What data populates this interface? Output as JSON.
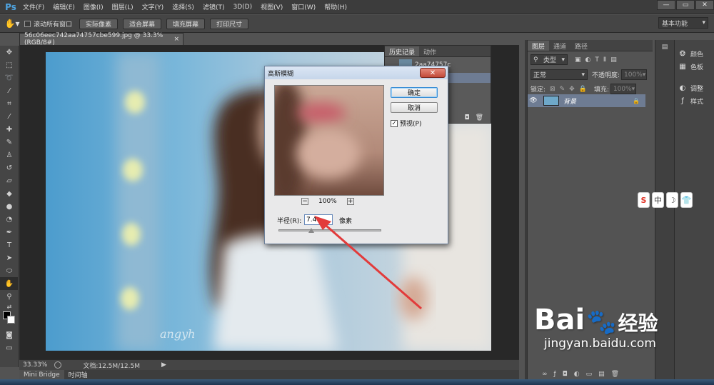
{
  "app": {
    "logo": "Ps"
  },
  "menu": [
    "文件(F)",
    "编辑(E)",
    "图像(I)",
    "图层(L)",
    "文字(Y)",
    "选择(S)",
    "滤镜(T)",
    "3D(D)",
    "视图(V)",
    "窗口(W)",
    "帮助(H)"
  ],
  "window_controls": {
    "minimize": "—",
    "restore": "▭",
    "close": "✕"
  },
  "options": {
    "scroll_all_label": "滚动所有窗口",
    "buttons": [
      "实际像素",
      "适合屏幕",
      "填充屏幕",
      "打印尺寸"
    ],
    "workspace": "基本功能"
  },
  "document": {
    "tab_title": "56c06eec742aa74757cbe599.jpg @ 33.3%(RGB/8#)",
    "tab_close": "×",
    "zoom": "33.33%",
    "doc_info": "文档:12.5M/12.5M"
  },
  "bottom_tabs": [
    "Mini Bridge",
    "时间轴"
  ],
  "history_panel": {
    "tabs": [
      "历史记录",
      "动作"
    ],
    "snapshot_name": "2aa74757c"
  },
  "dialog": {
    "title": "高斯模糊",
    "close": "✕",
    "ok_label": "确定",
    "cancel_label": "取消",
    "preview_label": "预视(P)",
    "preview_checked": true,
    "zoom_label": "100%",
    "zoom_minus": "−",
    "zoom_plus": "+",
    "radius_label": "半径(R):",
    "radius_value": "7.4",
    "radius_unit": "像素"
  },
  "layers_panel": {
    "tabs": [
      "图层",
      "通道",
      "路径"
    ],
    "filter_kind": "类型",
    "blend_mode": "正常",
    "opacity_label": "不透明度:",
    "opacity_value": "100%",
    "lock_label": "锁定:",
    "fill_label": "填充:",
    "fill_value": "100%",
    "layer_name": "背景"
  },
  "right_panel": {
    "items": [
      "颜色",
      "色板",
      "调整",
      "样式"
    ]
  },
  "ime": [
    "S",
    "中",
    "☽",
    "👕"
  ],
  "watermark": {
    "brand": "Bai",
    "brand2": "经验",
    "url": "jingyan.baidu.com"
  }
}
